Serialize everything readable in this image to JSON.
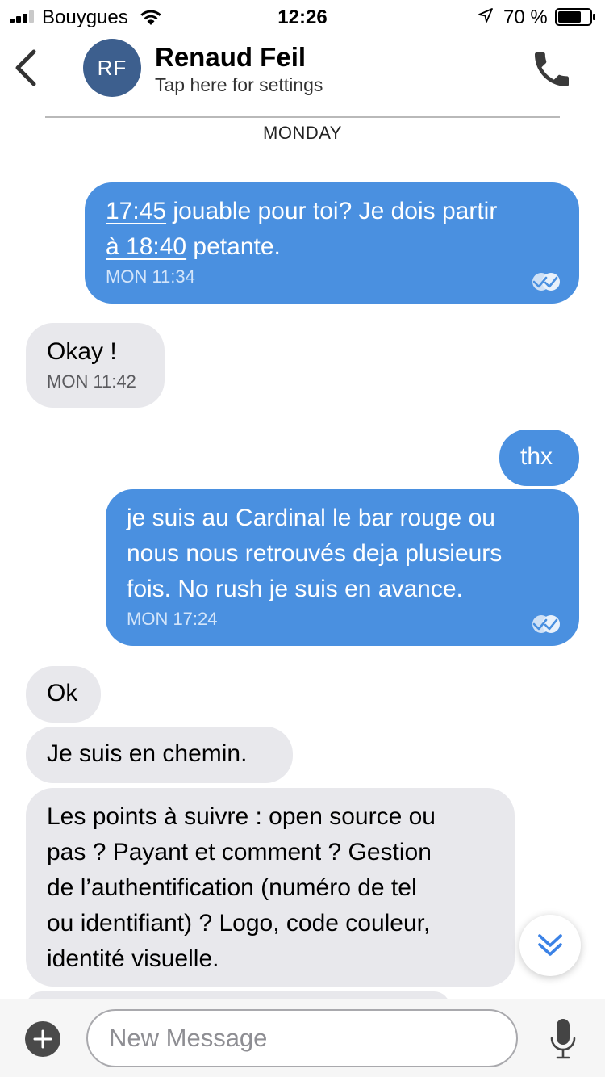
{
  "status_bar": {
    "carrier": "Bouygues",
    "time": "12:26",
    "battery_percent": "70 %"
  },
  "header": {
    "avatar_initials": "RF",
    "contact_name": "Renaud Feil",
    "subtitle": "Tap here for settings"
  },
  "day_separator": "MONDAY",
  "messages": [
    {
      "direction": "outgoing",
      "text_link_1": "17:45",
      "text_part_1": " jouable pour toi? Je dois partir",
      "text_link_2": "à 18:40",
      "text_part_2": " petante.",
      "time": "MON 11:34",
      "read": true
    },
    {
      "direction": "incoming",
      "text": "Okay !",
      "time": "MON 11:42"
    },
    {
      "direction": "outgoing",
      "text": "thx"
    },
    {
      "direction": "outgoing",
      "text_lines": [
        "je suis au Cardinal le bar rouge ou",
        "nous nous retrouvés deja plusieurs",
        "fois. No rush je suis en avance."
      ],
      "time": "MON 17:24",
      "read": true
    },
    {
      "direction": "incoming",
      "text": "Ok"
    },
    {
      "direction": "incoming",
      "text": "Je suis en chemin."
    },
    {
      "direction": "incoming",
      "text_lines": [
        "Les points à suivre : open source ou",
        "pas ? Payant et comment ? Gestion",
        "de l’authentification (numéro de tel",
        "ou identifiant) ? Logo, code couleur,",
        "identité visuelle."
      ]
    }
  ],
  "composer": {
    "placeholder": "New Message"
  },
  "colors": {
    "outgoing_bubble": "#4a90e0",
    "incoming_bubble": "#e8e8ec",
    "avatar": "#3d5f8e",
    "accent": "#3b82e6"
  },
  "icons": {
    "back": "chevron-left-icon",
    "call": "phone-icon",
    "read": "double-check-icon",
    "scroll": "double-chevron-down-icon",
    "add": "plus-icon",
    "mic": "microphone-icon"
  }
}
